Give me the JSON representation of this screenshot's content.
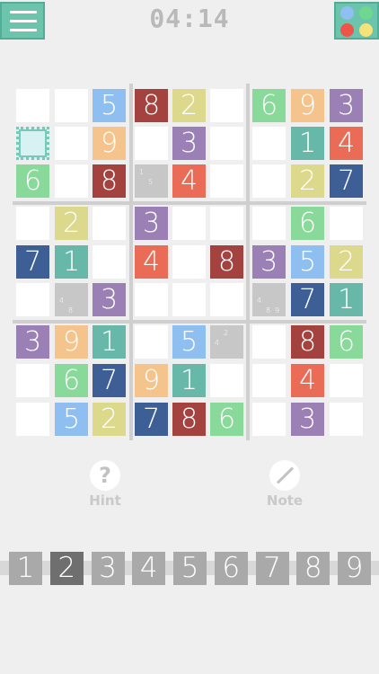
{
  "header": {
    "timer": "04:14",
    "menu_icon": "hamburger-icon",
    "theme_icon": "color-palette-icon",
    "theme_dots": [
      "#8fbff0",
      "#6fd78f",
      "#ef5448",
      "#f5e27a"
    ]
  },
  "colors": {
    "1": "#67b8a8",
    "2": "#dcd88c",
    "3": "#9b80b5",
    "4": "#ea6c57",
    "5": "#8fbff0",
    "6": "#89d99a",
    "7": "#3d5f96",
    "8": "#a4423f",
    "9": "#f5c48d",
    "empty": "#ffffff",
    "notes": "#c7c7c7",
    "selected": "#d8f2f3"
  },
  "board": {
    "values": [
      [
        "",
        "",
        "5",
        "8",
        "2",
        "",
        "6",
        "9",
        "3"
      ],
      [
        "",
        "",
        "9",
        "",
        "3",
        "",
        "",
        "1",
        "4"
      ],
      [
        "6",
        "",
        "8",
        "",
        "4",
        "",
        "",
        "2",
        "7"
      ],
      [
        "",
        "2",
        "",
        "3",
        "",
        "",
        "",
        "6",
        ""
      ],
      [
        "7",
        "1",
        "",
        "4",
        "",
        "8",
        "3",
        "5",
        "2"
      ],
      [
        "",
        "",
        "3",
        "",
        "",
        "",
        "",
        "7",
        "1"
      ],
      [
        "3",
        "9",
        "1",
        "",
        "5",
        "",
        "",
        "8",
        "6"
      ],
      [
        "",
        "6",
        "7",
        "9",
        "1",
        "",
        "",
        "4",
        ""
      ],
      [
        "",
        "5",
        "2",
        "7",
        "8",
        "6",
        "",
        "3",
        ""
      ]
    ],
    "notes": [
      {
        "row": 2,
        "col": 3,
        "digits": [
          "1",
          "5"
        ]
      },
      {
        "row": 5,
        "col": 1,
        "digits": [
          "4",
          "8"
        ]
      },
      {
        "row": 5,
        "col": 6,
        "digits": [
          "4",
          "8",
          "9"
        ]
      },
      {
        "row": 6,
        "col": 5,
        "digits": [
          "2",
          "4"
        ]
      }
    ],
    "selected": {
      "row": 1,
      "col": 0
    }
  },
  "tools": {
    "hint_label": "Hint",
    "hint_symbol": "?",
    "hint_icon": "question-mark-icon",
    "note_label": "Note",
    "note_icon": "pencil-icon"
  },
  "numpad": {
    "digits": [
      "1",
      "2",
      "3",
      "4",
      "5",
      "6",
      "7",
      "8",
      "9"
    ],
    "active": "2"
  }
}
